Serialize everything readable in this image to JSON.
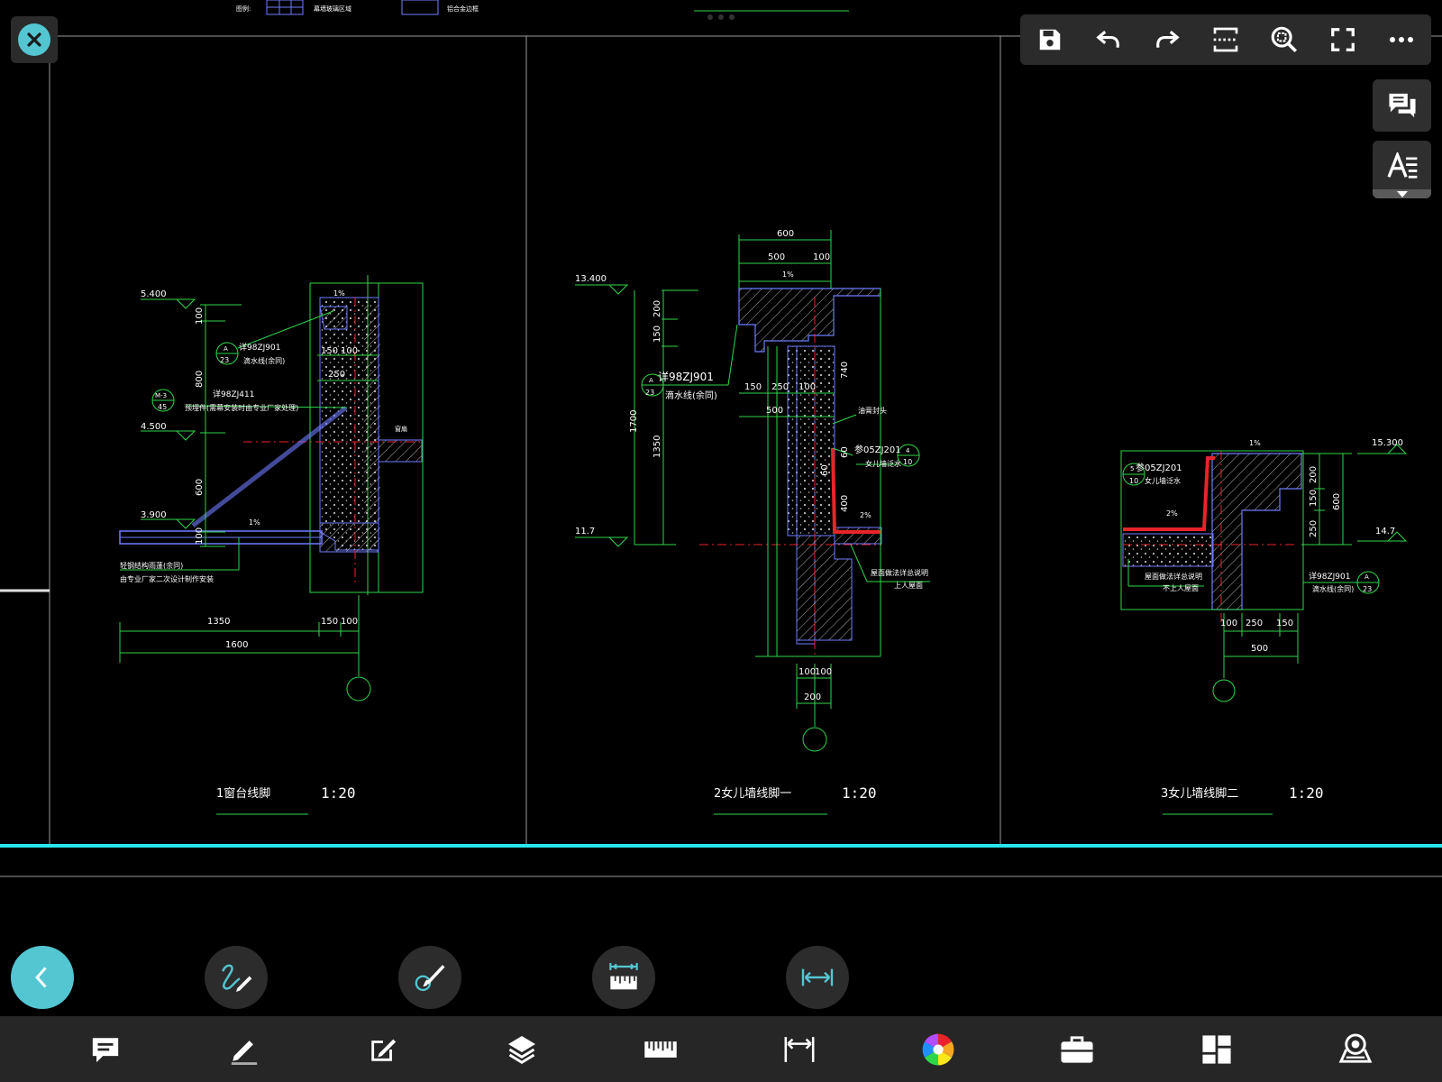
{
  "legend": {
    "item1": "图例:",
    "item2": "幕墙玻璃区域",
    "item3": "铝合金边框"
  },
  "details": [
    {
      "number": "1",
      "name": "窗台线脚",
      "scale": "1:20",
      "elevations": [
        "5.400",
        "4.500",
        "3.900"
      ],
      "vertical_dims": [
        "100",
        "800",
        "600",
        "100"
      ],
      "horizontal_dims_top": [
        "150",
        "100",
        "250"
      ],
      "horizontal_dims_bottom": [
        "1350",
        "150",
        "100",
        "1600"
      ],
      "slope": "1%",
      "notes": [
        "详98ZJ901",
        "滴水线(余同)",
        "详98ZJ411",
        "预埋件(需幕安装时由专业厂家处理)",
        "轻钢结构雨蓬(余同)",
        "由专业厂家二次设计制作安装",
        "窗扇"
      ],
      "refs": [
        {
          "top": "A",
          "bottom": "23"
        },
        {
          "top": "M-3",
          "bottom": "45"
        }
      ]
    },
    {
      "number": "2",
      "name": "女儿墙线脚一",
      "scale": "1:20",
      "elevations": [
        "13.400",
        "11.7"
      ],
      "vertical_dims": [
        "200",
        "150",
        "1700",
        "1350",
        "740",
        "60",
        "60",
        "400"
      ],
      "horizontal_dims_top": [
        "600",
        "500",
        "100"
      ],
      "horizontal_dims_mid": [
        "150",
        "250",
        "100",
        "500"
      ],
      "horizontal_dims_bottom": [
        "100",
        "100",
        "200"
      ],
      "slopes": [
        "1%",
        "2%"
      ],
      "notes": [
        "详98ZJ901",
        "滴水线(余同)",
        "油膏封头",
        "参05ZJ201",
        "女儿墙泛水",
        "屋面做法详总说明",
        "上人屋面"
      ],
      "refs": [
        {
          "top": "A",
          "bottom": "23"
        },
        {
          "top": "4",
          "bottom": "10"
        }
      ]
    },
    {
      "number": "3",
      "name": "女儿墙线脚二",
      "scale": "1:20",
      "elevations": [
        "15.300",
        "14.7"
      ],
      "vertical_dims": [
        "200",
        "150",
        "250",
        "600"
      ],
      "horizontal_dims_bottom": [
        "100",
        "250",
        "150",
        "500"
      ],
      "slopes": [
        "1%",
        "2%"
      ],
      "notes": [
        "参05ZJ201",
        "女儿墙泛水",
        "屋面做法详总说明",
        "不上人屋面",
        "详98ZJ901",
        "滴水线(余同)"
      ],
      "refs": [
        {
          "top": "5",
          "bottom": "10"
        },
        {
          "top": "A",
          "bottom": "23"
        }
      ]
    }
  ],
  "top_toolbar": [
    "save-icon",
    "undo-icon",
    "redo-icon",
    "crop-icon",
    "zoom-extents-icon",
    "fullscreen-icon",
    "more-icon"
  ],
  "side_tools": [
    "comments-icon",
    "text-style-icon"
  ],
  "floating_tools": [
    "back-icon",
    "freehand-icon",
    "brush-icon",
    "measure-ruler-icon",
    "dimension-icon"
  ],
  "bottom_bar": [
    "comment-icon",
    "pen-icon",
    "edit-icon",
    "layers-icon",
    "ruler-icon",
    "dimension-icon",
    "color-wheel-icon",
    "toolbox-icon",
    "grid-icon",
    "3d-view-icon"
  ],
  "colors": {
    "accent": "#53c6d2",
    "cad_green": "#2fd64a",
    "cad_red": "#e8242a",
    "cad_blue": "#6f7bff",
    "panel": "#2b2b2b",
    "bottom_bar": "#262626"
  }
}
